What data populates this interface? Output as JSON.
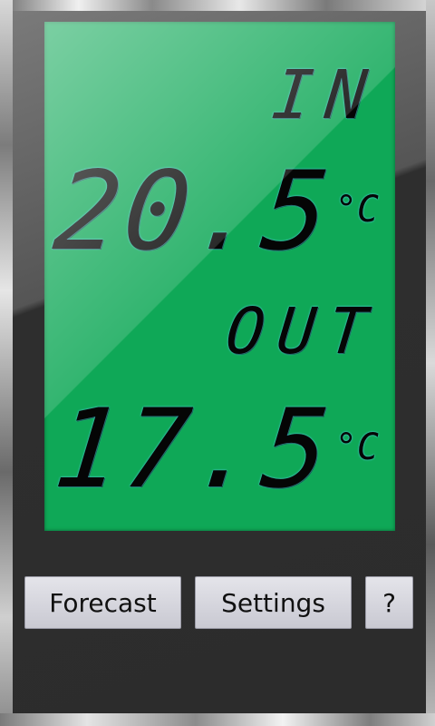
{
  "display": {
    "inside_label": "IN",
    "inside_temp": "20.5",
    "inside_unit": "°C",
    "outside_label": "OUT",
    "outside_temp": "17.5",
    "outside_unit": "°C"
  },
  "buttons": {
    "forecast": "Forecast",
    "settings": "Settings",
    "help": "?"
  },
  "colors": {
    "lcd_background": "#0fa857",
    "segment_color": "#050505",
    "segment_glow": "#5ad6ff",
    "button_face": "#d8d8e0"
  }
}
